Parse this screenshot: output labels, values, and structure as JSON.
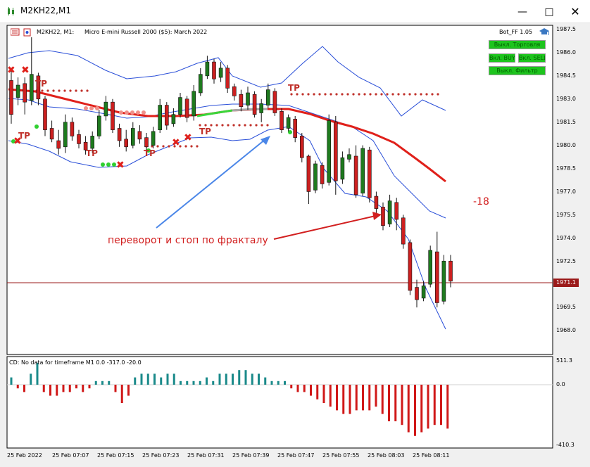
{
  "window": {
    "title": "M2KH22,M1",
    "min_glyph": "—",
    "max_glyph": "□",
    "close_glyph": "✕"
  },
  "chart_header": {
    "symbol": "M2KH22, M1:",
    "description": "Micro E-mini Russell 2000 ($5): March 2022"
  },
  "bot": {
    "name": "Bot_FF 1.05",
    "btn_trading": "Выкл. Торговля",
    "btn_buy": "Вкл. BUY",
    "btn_sell": "Вкл. SELL",
    "btn_filter": "Выкл. Фильтр"
  },
  "annotations": {
    "reversal": "переворот и стоп по фракталу",
    "score": "-18",
    "tp": "TP"
  },
  "current_price": "1971.1",
  "main_axis": [
    "1987.5",
    "1986.0",
    "1984.5",
    "1983.0",
    "1981.5",
    "1980.0",
    "1978.5",
    "1977.0",
    "1975.5",
    "1974.0",
    "1972.5",
    "1971.0",
    "1969.5",
    "1968.0"
  ],
  "time_axis": [
    "25 Feb 2022",
    "25 Feb 07:07",
    "25 Feb 07:15",
    "25 Feb 07:23",
    "25 Feb 07:31",
    "25 Feb 07:39",
    "25 Feb 07:47",
    "25 Feb 07:55",
    "25 Feb 08:03",
    "25 Feb 08:11"
  ],
  "indicator": {
    "label": "CD: No data for timeframe M1 0.0 -317.0 -20.0",
    "axis": [
      "511.3",
      "0.0",
      "-410.3"
    ]
  },
  "colors": {
    "bull_candle": "#1e7a1e",
    "bear_candle": "#cc1f1f",
    "ema": "#e0201a",
    "bands": "#2a4fd8",
    "hist_pos": "#1a8a8a",
    "hist_neg": "#d01818"
  }
}
